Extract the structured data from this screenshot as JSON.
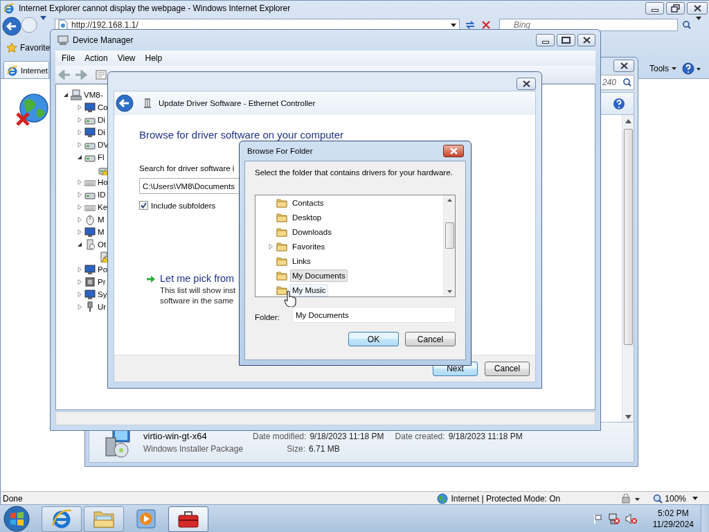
{
  "browser": {
    "title": "Internet Explorer cannot display the webpage - Windows Internet Explorer",
    "address": "http://192.168.1.1/",
    "search_placeholder": "Bing",
    "favorites": "Favorite",
    "tab": "Internet",
    "tools": "Tools",
    "status": "Done",
    "zone": "Internet | Protected Mode: On",
    "zoom": "100%"
  },
  "explorer": {
    "search_value": "240",
    "file": {
      "name": "virtio-win-gt-x64",
      "type": "Windows Installer Package",
      "details": [
        {
          "label": "Date modified:",
          "value": "9/18/2023 11:18 PM"
        },
        {
          "label": "Size:",
          "value": "6.71 MB"
        },
        {
          "label": "Date created:",
          "value": "9/18/2023 11:18 PM"
        }
      ]
    }
  },
  "device_manager": {
    "title": "Device Manager",
    "menu": [
      "File",
      "Action",
      "View",
      "Help"
    ],
    "tree": {
      "label": "VM8-",
      "kind": "computer",
      "expanded": true,
      "children": [
        {
          "label": "Co",
          "kind": "monitor",
          "expanded": false
        },
        {
          "label": "Di",
          "kind": "drive",
          "expanded": false
        },
        {
          "label": "Di",
          "kind": "monitor",
          "expanded": false
        },
        {
          "label": "DV",
          "kind": "drive",
          "expanded": false
        },
        {
          "label": "Fl",
          "kind": "drive",
          "expanded": true,
          "children": [
            {
              "kind": "drive",
              "warning": true
            }
          ]
        },
        {
          "label": "Ho",
          "kind": "keyboard",
          "expanded": false
        },
        {
          "label": "ID",
          "kind": "drive",
          "expanded": false
        },
        {
          "label": "Ke",
          "kind": "keyboard",
          "expanded": false
        },
        {
          "label": "M",
          "kind": "mouse",
          "expanded": false
        },
        {
          "label": "M",
          "kind": "monitor",
          "expanded": false
        },
        {
          "label": "Ot",
          "kind": "device",
          "expanded": true,
          "children": [
            {
              "kind": "device",
              "warning": true
            }
          ]
        },
        {
          "label": "Po",
          "kind": "monitor",
          "expanded": false
        },
        {
          "label": "Pr",
          "kind": "chip",
          "expanded": false
        },
        {
          "label": "Sy",
          "kind": "monitor",
          "expanded": false
        },
        {
          "label": "Ur",
          "kind": "plug",
          "expanded": false
        }
      ]
    }
  },
  "update_driver": {
    "title": "Update Driver Software - Ethernet Controller",
    "heading": "Browse for driver software on your computer",
    "search_label": "Search for driver software i",
    "path": "C:\\Users\\VM8\\Documents",
    "include_subfolders": {
      "label": "Include subfolders",
      "checked": true
    },
    "pick_link": "Let me pick from",
    "pick_description": [
      "This list will show inst",
      "software in the same"
    ],
    "buttons": [
      "Next",
      "Cancel"
    ]
  },
  "browse_dialog": {
    "title": "Browse For Folder",
    "instruction": "Select the folder that contains drivers for your hardware.",
    "folders": [
      {
        "label": "Contacts",
        "expandable": false,
        "selected": false,
        "hot": false
      },
      {
        "label": "Desktop",
        "expandable": false,
        "selected": false,
        "hot": false
      },
      {
        "label": "Downloads",
        "expandable": false,
        "selected": false,
        "hot": false
      },
      {
        "label": "Favorites",
        "expandable": true,
        "selected": false,
        "hot": false
      },
      {
        "label": "Links",
        "expandable": false,
        "selected": false,
        "hot": false
      },
      {
        "label": "My Documents",
        "expandable": false,
        "selected": true,
        "hot": false
      },
      {
        "label": "My Music",
        "expandable": false,
        "selected": false,
        "hot": true
      }
    ],
    "folder_label": "Folder:",
    "folder_value": "My Documents",
    "buttons": [
      "OK",
      "Cancel"
    ]
  },
  "taskbar": {
    "apps": [
      {
        "kind": "browser",
        "running": true,
        "selected": false
      },
      {
        "kind": "explorer",
        "running": true,
        "selected": false
      },
      {
        "kind": "media",
        "running": false,
        "selected": false
      },
      {
        "kind": "toolbox",
        "running": true,
        "selected": true
      }
    ],
    "time": "5:02 PM",
    "date": "11/29/2024"
  }
}
